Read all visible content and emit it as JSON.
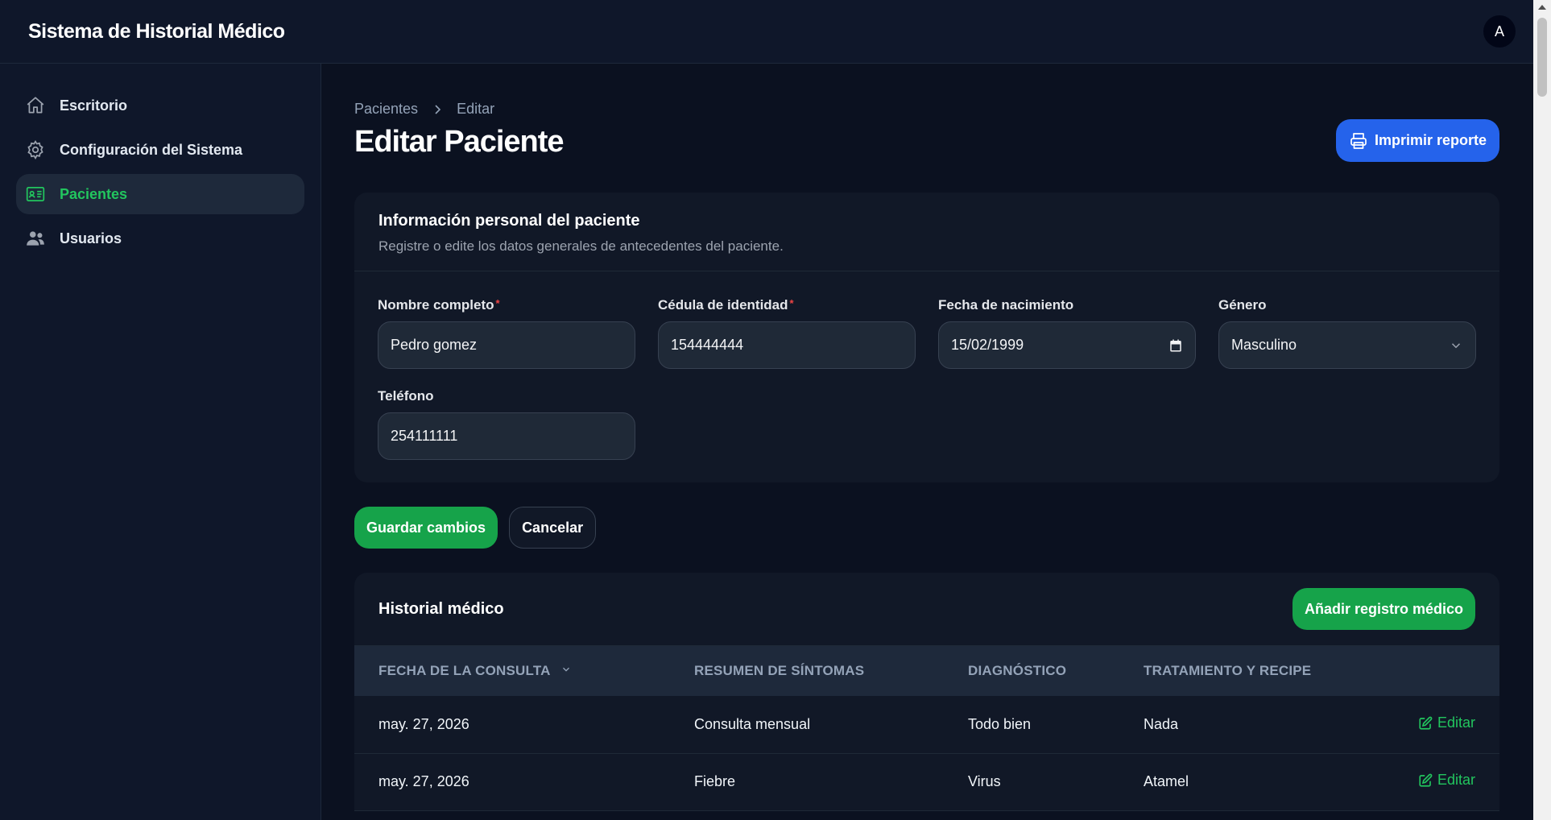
{
  "app": {
    "title": "Sistema de Historial Médico",
    "avatar_initial": "A"
  },
  "sidebar": {
    "items": [
      {
        "label": "Escritorio",
        "icon": "home-icon",
        "active": false
      },
      {
        "label": "Configuración del Sistema",
        "icon": "gear-icon",
        "active": false
      },
      {
        "label": "Pacientes",
        "icon": "id-card-icon",
        "active": true
      },
      {
        "label": "Usuarios",
        "icon": "users-icon",
        "active": false
      }
    ]
  },
  "breadcrumb": {
    "parent": "Pacientes",
    "current": "Editar"
  },
  "page": {
    "title": "Editar Paciente",
    "print_label": "Imprimir reporte"
  },
  "personal": {
    "title": "Información personal del paciente",
    "subtitle": "Registre o edite los datos generales de antecedentes del paciente.",
    "fields": {
      "name": {
        "label": "Nombre completo",
        "value": "Pedro gomez",
        "required": true
      },
      "id": {
        "label": "Cédula de identidad",
        "value": "154444444",
        "required": true
      },
      "birth": {
        "label": "Fecha de nacimiento",
        "value": "15/02/1999"
      },
      "gender": {
        "label": "Género",
        "value": "Masculino"
      },
      "phone": {
        "label": "Teléfono",
        "value": "254111111"
      }
    }
  },
  "actions": {
    "save_label": "Guardar cambios",
    "cancel_label": "Cancelar"
  },
  "history": {
    "title": "Historial médico",
    "add_label": "Añadir registro médico",
    "columns": [
      "Fecha de la consulta",
      "Resumen de síntomas",
      "Diagnóstico",
      "Tratamiento y recipe"
    ],
    "edit_label": "Editar",
    "rows": [
      {
        "date": "may. 27, 2026",
        "symptoms": "Consulta mensual",
        "diagnosis": "Todo bien",
        "treatment": "Nada"
      },
      {
        "date": "may. 27, 2026",
        "symptoms": "Fiebre",
        "diagnosis": "Virus",
        "treatment": "Atamel"
      }
    ]
  },
  "colors": {
    "accent_green": "#22c55e",
    "primary_blue": "#2563eb",
    "background": "#0b1120"
  }
}
